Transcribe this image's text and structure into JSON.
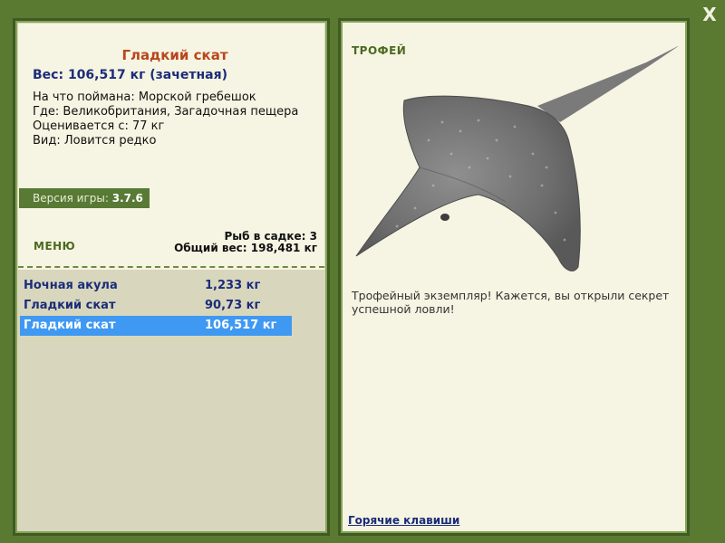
{
  "fish": {
    "name": "Гладкий скат",
    "weight": "Вес: 106,517 кг (зачетная)",
    "caught_on": "На что поймана: Морской гребешок",
    "location": "Где: Великобритания, Загадочная пещера",
    "rated_from": "Оценивается с: 77 кг",
    "kind": "Вид: Ловится редко"
  },
  "version": {
    "label": "Версия игры:",
    "value": "3.7.6"
  },
  "menu": {
    "label": "МЕНЮ"
  },
  "stats": {
    "fish_count": "Рыб в садке: 3",
    "total_weight": "Общий вес: 198,481 кг"
  },
  "list": [
    {
      "name": "Ночная акула",
      "weight": "1,233 кг"
    },
    {
      "name": "Гладкий скат",
      "weight": "90,73 кг"
    },
    {
      "name": "Гладкий скат",
      "weight": "106,517 кг"
    }
  ],
  "trophy": {
    "label": "ТРОФЕЙ",
    "description": "Трофейный экземпляр! Кажется, вы открыли секрет успешной ловли!"
  },
  "hotkeys": "Горячие клавиши",
  "close": "X",
  "icons": {
    "close": "close-icon",
    "fish": "stingray-image"
  },
  "colors": {
    "background": "#5a7a32",
    "selected": "#3f98f2",
    "title": "#b8461d",
    "text": "#1b2c7a"
  }
}
